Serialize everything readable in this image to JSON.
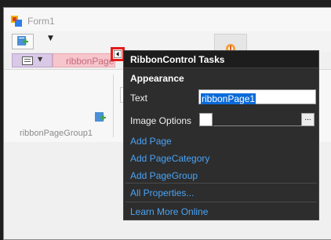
{
  "window": {
    "title": "Form1",
    "qat_customize_glyph": "▼"
  },
  "ribbon": {
    "app_menu_caret": "▼",
    "page_tab": "ribbonPage",
    "group_label": "ribbonPageGroup1"
  },
  "smart_tag": {
    "icon": "chevron-left-icon"
  },
  "tasks_popup": {
    "title": "RibbonControl Tasks",
    "section": "Appearance",
    "text_label": "Text",
    "text_value": "ribbonPage1",
    "image_options_label": "Image Options",
    "ellipsis_label": "...",
    "links": {
      "add_page": "Add Page",
      "add_page_category": "Add PageCategory",
      "add_page_group": "Add PageGroup",
      "all_properties": "All Properties...",
      "learn_more": "Learn More Online"
    }
  },
  "colors": {
    "highlight_border": "#e41b1b",
    "link": "#4aa3f5",
    "selection": "#0a6bd8",
    "page_tab_bg": "#f6c6cc",
    "app_tab_bg": "#d9c8e6"
  }
}
